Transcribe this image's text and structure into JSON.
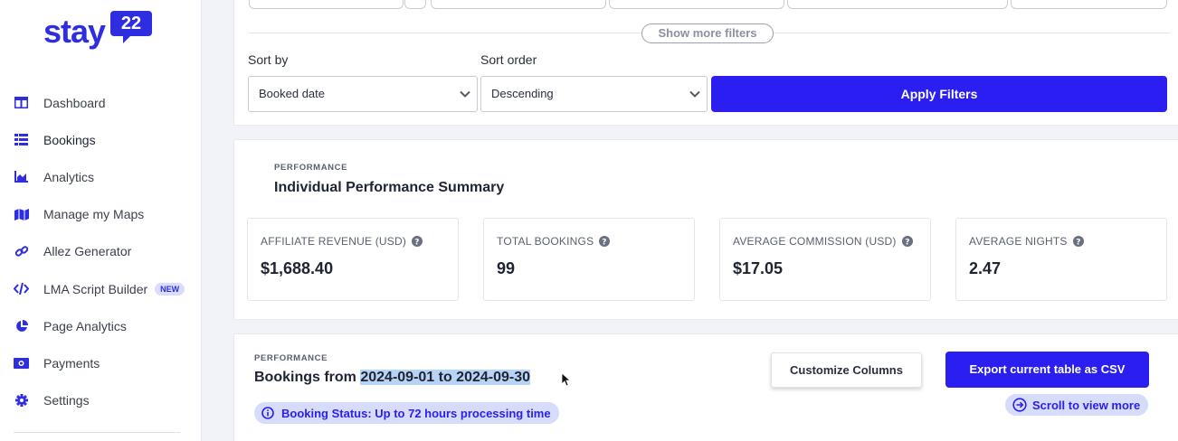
{
  "brand": {
    "logo_text": "stay",
    "logo_badge": "22",
    "color": "#2e2ee0"
  },
  "sidebar": {
    "items": [
      {
        "label": "Dashboard",
        "icon": "dashboard-icon"
      },
      {
        "label": "Bookings",
        "icon": "list-icon"
      },
      {
        "label": "Analytics",
        "icon": "chart-icon"
      },
      {
        "label": "Manage my Maps",
        "icon": "map-icon"
      },
      {
        "label": "Allez Generator",
        "icon": "link-icon"
      },
      {
        "label": "LMA Script Builder",
        "icon": "code-icon",
        "badge": "NEW"
      },
      {
        "label": "Page Analytics",
        "icon": "pie-icon"
      },
      {
        "label": "Payments",
        "icon": "money-icon"
      },
      {
        "label": "Settings",
        "icon": "gear-icon"
      }
    ]
  },
  "filters": {
    "show_more": "Show more filters",
    "sort_by_label": "Sort by",
    "sort_by_value": "Booked date",
    "sort_order_label": "Sort order",
    "sort_order_value": "Descending",
    "apply_label": "Apply Filters"
  },
  "performance": {
    "eyebrow": "PERFORMANCE",
    "title": "Individual Performance Summary",
    "stats": [
      {
        "label": "AFFILIATE REVENUE (USD)",
        "value": "$1,688.40"
      },
      {
        "label": "TOTAL BOOKINGS",
        "value": "99"
      },
      {
        "label": "AVERAGE COMMISSION (USD)",
        "value": "$17.05"
      },
      {
        "label": "AVERAGE NIGHTS",
        "value": "2.47"
      }
    ]
  },
  "bookings": {
    "eyebrow": "PERFORMANCE",
    "title_prefix": "Bookings from ",
    "title_range": "2024-09-01 to 2024-09-30",
    "status_note": "Booking Status: Up to 72 hours processing time",
    "customize_label": "Customize Columns",
    "export_label": "Export current table as CSV",
    "scroll_hint": "Scroll to view more"
  }
}
